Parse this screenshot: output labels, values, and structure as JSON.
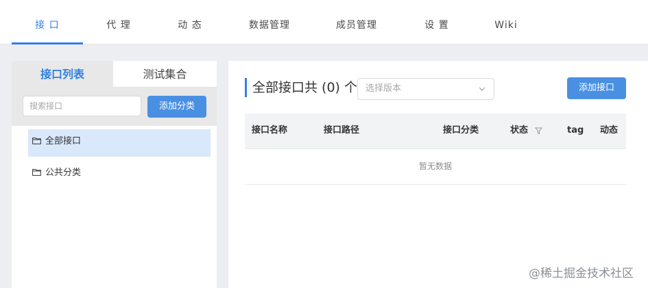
{
  "nav": {
    "tabs": [
      {
        "label": "接 口"
      },
      {
        "label": "代 理"
      },
      {
        "label": "动 态"
      },
      {
        "label": "数据管理"
      },
      {
        "label": "成员管理"
      },
      {
        "label": "设 置"
      },
      {
        "label": "Wiki"
      }
    ],
    "active_index": 0
  },
  "sidebar": {
    "segments": [
      {
        "label": "接口列表"
      },
      {
        "label": "测试集合"
      }
    ],
    "search": {
      "placeholder": "搜索接口",
      "value": ""
    },
    "add_category_label": "添加分类",
    "tree": [
      {
        "label": "全部接口",
        "selected": true,
        "icon": "folder-icon"
      },
      {
        "label": "公共分类",
        "selected": false,
        "icon": "folder-icon"
      }
    ]
  },
  "main": {
    "title": "全部接口共 (0) 个",
    "version_select": {
      "placeholder": "选择版本"
    },
    "add_api_label": "添加接口",
    "table": {
      "columns": [
        "接口名称",
        "接口路径",
        "接口分类",
        "状态",
        "tag",
        "动态"
      ],
      "empty_text": "暂无数据",
      "rows": []
    }
  },
  "watermark": "@稀土掘金技术社区",
  "colors": {
    "accent": "#2f7fe6",
    "button": "#4a90e2",
    "selected_bg": "#d9e8fb",
    "page_bg": "#eceef1"
  }
}
